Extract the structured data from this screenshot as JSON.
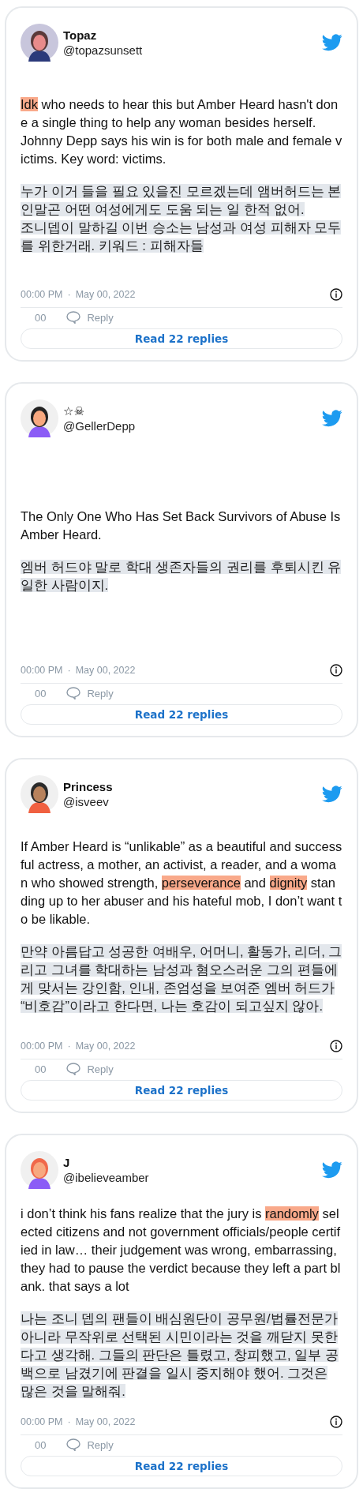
{
  "tweets": [
    {
      "name": "Topaz",
      "handle": "@topazsunsett",
      "english": [
        [
          {
            "text": "Idk",
            "highlighted": true
          },
          {
            "text": " who needs to hear this but Amber Heard hasn't done a single thing to help any woman besides herself.",
            "highlighted": false
          }
        ],
        [
          {
            "text": "Johnny Depp says his win is for both male and female victims. Key word: victims.",
            "highlighted": false
          }
        ]
      ],
      "korean": [
        "누가 이거 들을 필요 있을진 모르겠는데 앰버허드는 본인말곤 어떤 여성에게도 도움 되는 일 한적 없어.",
        "조니뎁이 말하길 이번 승소는 남성과 여성 피해자 모두를 위한거래. 키워드 : 피해자들"
      ],
      "time": "00:00 PM",
      "separator": "·",
      "date": "May 00, 2022",
      "likes": "00",
      "reply": "Reply",
      "read_replies": "Read 22 replies"
    },
    {
      "name": "☆☠",
      "handle": "@GellerDepp",
      "english": [
        [
          {
            "text": "The Only One Who Has Set Back Survivors of Abuse Is Amber Heard.",
            "highlighted": false
          }
        ]
      ],
      "korean": [
        "엠버 허드야 말로 학대 생존자들의 권리를 후퇴시킨 유일한 사람이지."
      ],
      "time": "00:00 PM",
      "separator": "·",
      "date": "May 00, 2022",
      "likes": "00",
      "reply": "Reply",
      "read_replies": "Read 22 replies"
    },
    {
      "name": "Princess",
      "handle": "@isveev",
      "english": [
        [
          {
            "text": "If Amber Heard is “unlikable” as a beautiful and successful actress, a mother, an activist, a reader, and a woman who showed strength, ",
            "highlighted": false
          },
          {
            "text": "perseverance",
            "highlighted": true
          },
          {
            "text": " and ",
            "highlighted": false
          },
          {
            "text": "dignity",
            "highlighted": true
          },
          {
            "text": " standing up to her abuser and his hateful mob, I don’t want to be likable.",
            "highlighted": false
          }
        ]
      ],
      "korean": [
        "만약 아름답고 성공한 여배우, 어머니, 활동가, 리더, 그리고 그녀를 학대하는 남성과 혐오스러운 그의 편들에게 맞서는 강인함, 인내, 존엄성을 보여준 엠버 허드가 “비호감”이라고 한다면, 나는 호감이 되고싶지 않아."
      ],
      "time": "00:00 PM",
      "separator": "·",
      "date": "May 00, 2022",
      "likes": "00",
      "reply": "Reply",
      "read_replies": "Read 22 replies"
    },
    {
      "name": "J",
      "handle": "@ibelieveamber",
      "english": [
        [
          {
            "text": "i don’t think his fans realize that the jury is ",
            "highlighted": false
          },
          {
            "text": "randomly",
            "highlighted": true
          },
          {
            "text": " selected citizens and not government officials/people certified in law… their judgement was wrong, embarrassing, they had to pause the verdict because they left a part blank. that says a lot",
            "highlighted": false
          }
        ]
      ],
      "korean": [
        "나는 조니 뎁의 팬들이 배심원단이 공무원/법률전문가 아니라 무작위로 선택된 시민이라는 것을 깨닫지 못한다고 생각해. 그들의 판단은 틀렸고, 창피했고, 일부 공백으로 남겼기에 판결을 일시 중지해야 했어. 그것은 많은 것을 말해줘."
      ],
      "time": "00:00 PM",
      "separator": "·",
      "date": "May 00, 2022",
      "likes": "00",
      "reply": "Reply",
      "read_replies": "Read 22 replies"
    }
  ]
}
